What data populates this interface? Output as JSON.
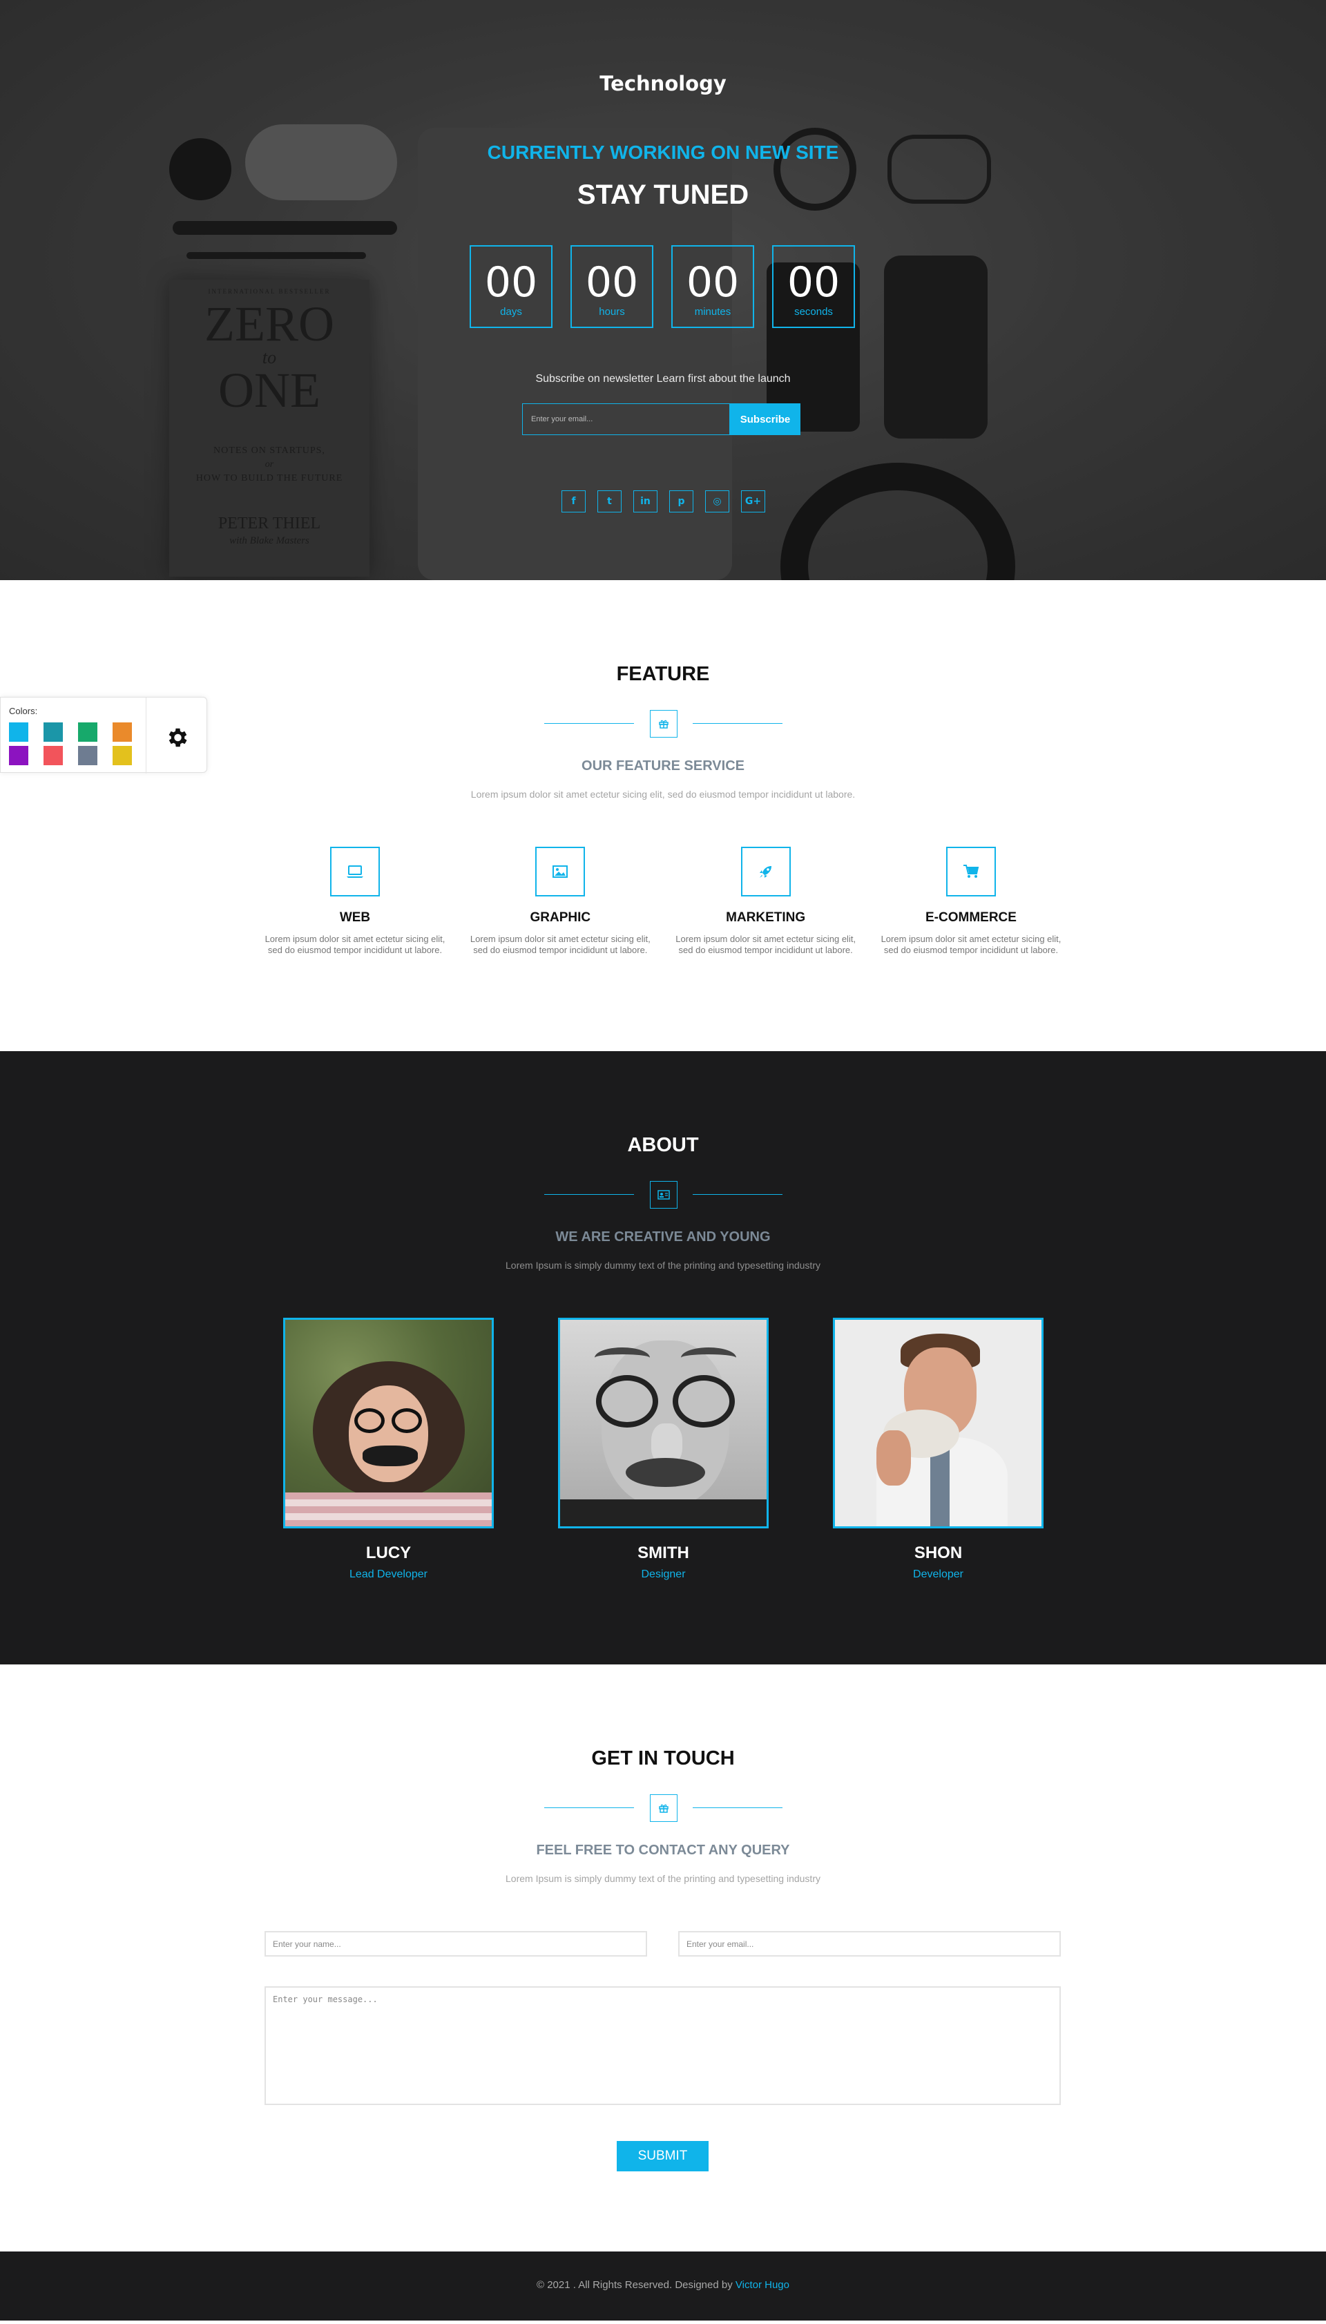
{
  "colors": {
    "accent": "#10b4ea",
    "dark": "#1b1b1c"
  },
  "hero": {
    "brand": "Technology",
    "subtitle": "CURRENTLY WORKING ON NEW SITE",
    "title": "STAY TUNED",
    "countdown": [
      {
        "value": "00",
        "label": "days"
      },
      {
        "value": "00",
        "label": "hours"
      },
      {
        "value": "00",
        "label": "minutes"
      },
      {
        "value": "00",
        "label": "seconds"
      }
    ],
    "newsletter_text": "Subscribe on newsletter Learn first about the launch",
    "email_placeholder": "Enter your email...",
    "subscribe_label": "Subscribe",
    "social": [
      {
        "name": "facebook-icon",
        "glyph": "f"
      },
      {
        "name": "twitter-icon",
        "glyph": "t"
      },
      {
        "name": "linkedin-icon",
        "glyph": "in"
      },
      {
        "name": "pinterest-icon",
        "glyph": "p"
      },
      {
        "name": "dribbble-icon",
        "glyph": "◎"
      },
      {
        "name": "google-plus-icon",
        "glyph": "G+"
      }
    ],
    "book": {
      "top_line": "INTERNATIONAL BESTSELLER",
      "title1": "ZERO",
      "title2": "to",
      "title3": "ONE",
      "notes1": "NOTES ON STARTUPS,",
      "notes2": "or",
      "notes3": "HOW TO BUILD THE FUTURE",
      "author": "PETER THIEL",
      "coauthor": "with Blake Masters"
    }
  },
  "color_switcher": {
    "label": "Colors:",
    "swatches": [
      "#10b4ea",
      "#1b96a8",
      "#17a96b",
      "#ea8a2b",
      "#8c13c0",
      "#f2545b",
      "#6e7c91",
      "#e3c11d"
    ]
  },
  "feature": {
    "title": "FEATURE",
    "subtitle": "OUR FEATURE SERVICE",
    "desc": "Lorem ipsum dolor sit amet ectetur sicing elit, sed do eiusmod tempor incididunt ut labore.",
    "items": [
      {
        "title": "WEB",
        "icon": "laptop-icon",
        "desc": "Lorem ipsum dolor sit amet ectetur sicing elit, sed do eiusmod tempor incididunt ut labore."
      },
      {
        "title": "GRAPHIC",
        "icon": "image-icon",
        "desc": "Lorem ipsum dolor sit amet ectetur sicing elit, sed do eiusmod tempor incididunt ut labore."
      },
      {
        "title": "MARKETING",
        "icon": "rocket-icon",
        "desc": "Lorem ipsum dolor sit amet ectetur sicing elit, sed do eiusmod tempor incididunt ut labore."
      },
      {
        "title": "E-COMMERCE",
        "icon": "cart-icon",
        "desc": "Lorem ipsum dolor sit amet ectetur sicing elit, sed do eiusmod tempor incididunt ut labore."
      }
    ]
  },
  "about": {
    "title": "ABOUT",
    "subtitle": "WE ARE CREATIVE AND YOUNG",
    "desc": "Lorem Ipsum is simply dummy text of the printing and typesetting industry",
    "team": [
      {
        "name": "LUCY",
        "role": "Lead Developer"
      },
      {
        "name": "SMITH",
        "role": "Designer"
      },
      {
        "name": "SHON",
        "role": "Developer"
      }
    ]
  },
  "contact": {
    "title": "GET IN TOUCH",
    "subtitle": "FEEL FREE TO CONTACT ANY QUERY",
    "desc": "Lorem Ipsum is simply dummy text of the printing and typesetting industry",
    "name_placeholder": "Enter your name...",
    "email_placeholder": "Enter your email...",
    "message_placeholder": "Enter your message...",
    "submit_label": "SUBMIT"
  },
  "footer": {
    "text": "© 2021 . All Rights Reserved. Designed by",
    "author": "Victor Hugo"
  }
}
